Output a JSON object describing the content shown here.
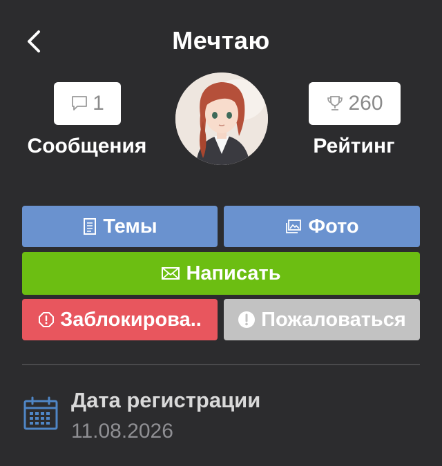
{
  "header": {
    "back_icon": "chevron-left-icon",
    "title": "Мечтаю"
  },
  "stats": {
    "messages": {
      "icon": "speech-bubble-icon",
      "count": "1",
      "label": "Сообщения"
    },
    "rating": {
      "icon": "trophy-icon",
      "count": "260",
      "label": "Рейтинг"
    }
  },
  "avatar": {
    "icon": "user-avatar"
  },
  "actions": {
    "topics": {
      "icon": "document-icon",
      "label": "Темы"
    },
    "photos": {
      "icon": "image-icon",
      "label": "Фото"
    },
    "write": {
      "icon": "envelope-icon",
      "label": "Написать"
    },
    "block": {
      "icon": "block-icon",
      "label": "Заблокирова.."
    },
    "report": {
      "icon": "exclamation-icon",
      "label": "Пожаловаться"
    }
  },
  "registration": {
    "icon": "calendar-icon",
    "label": "Дата регистрации",
    "date": "11.08.2026"
  },
  "colors": {
    "background": "#2c2c2e",
    "blue_button": "#6a92cf",
    "green_button": "#6cbe12",
    "red_button": "#e8565e",
    "gray_button": "#c2c2c2",
    "calendar_icon": "#4f86c6"
  }
}
